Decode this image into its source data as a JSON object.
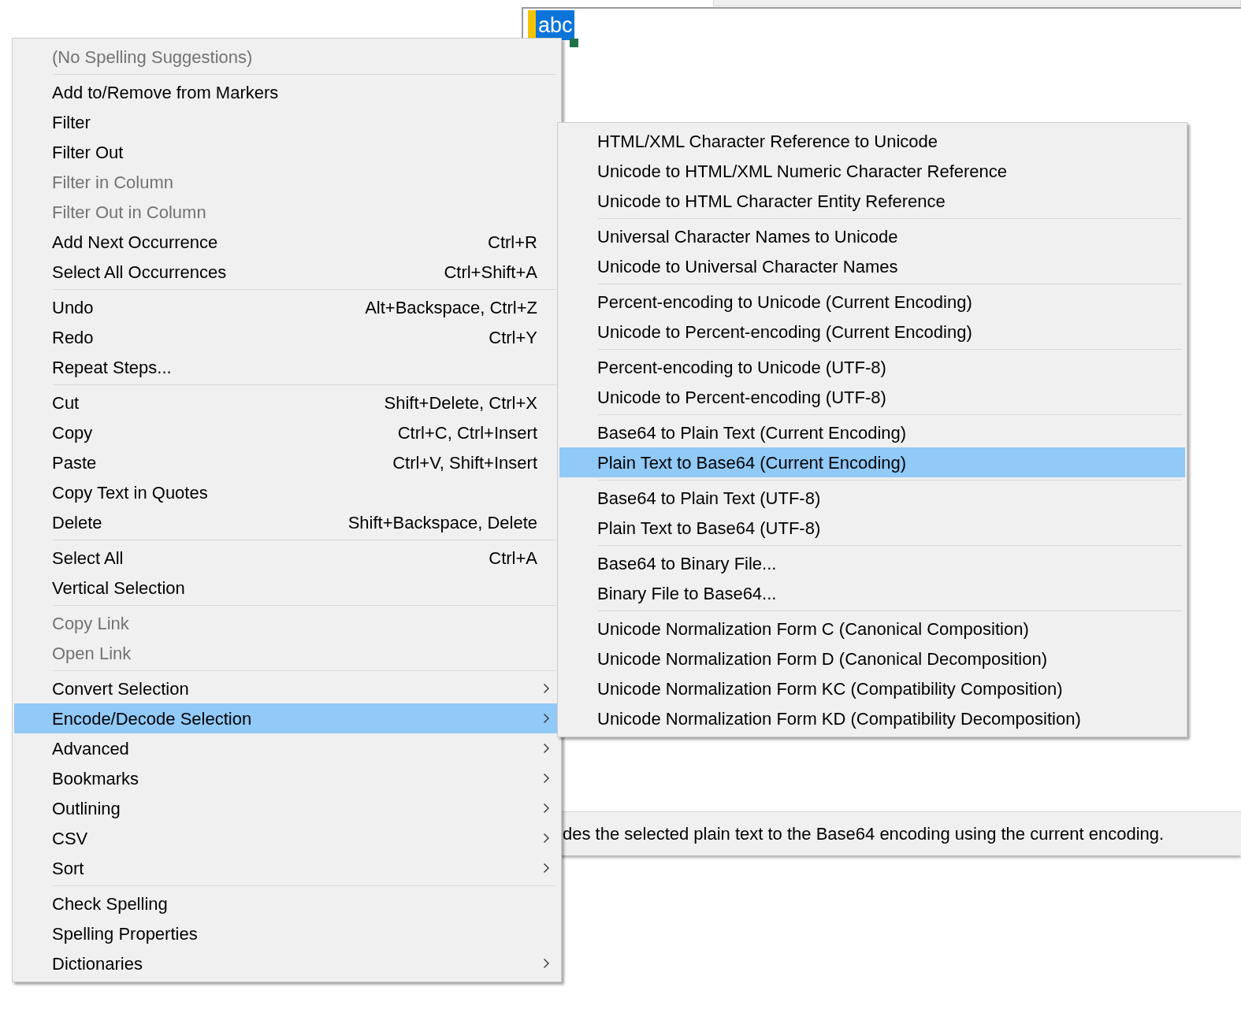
{
  "editor": {
    "text": "abc",
    "status_text": "des the selected plain text to the Base64 encoding using the current encoding."
  },
  "context_menu": {
    "groups": [
      [
        {
          "label": "(No Spelling Suggestions)",
          "disabled": true,
          "submenu": false,
          "selected": false
        }
      ],
      [
        {
          "label": "Add to/Remove from Markers",
          "disabled": false,
          "submenu": false,
          "selected": false
        },
        {
          "label": "Filter",
          "disabled": false,
          "submenu": false,
          "selected": false
        },
        {
          "label": "Filter Out",
          "disabled": false,
          "submenu": false,
          "selected": false
        },
        {
          "label": "Filter in Column",
          "disabled": true,
          "submenu": false,
          "selected": false
        },
        {
          "label": "Filter Out in Column",
          "disabled": true,
          "submenu": false,
          "selected": false
        },
        {
          "label": "Add Next Occurrence",
          "shortcut": "Ctrl+R",
          "disabled": false,
          "submenu": false,
          "selected": false
        },
        {
          "label": "Select All Occurrences",
          "shortcut": "Ctrl+Shift+A",
          "disabled": false,
          "submenu": false,
          "selected": false
        }
      ],
      [
        {
          "label": "Undo",
          "shortcut": "Alt+Backspace, Ctrl+Z",
          "disabled": false,
          "submenu": false,
          "selected": false
        },
        {
          "label": "Redo",
          "shortcut": "Ctrl+Y",
          "disabled": false,
          "submenu": false,
          "selected": false
        },
        {
          "label": "Repeat Steps...",
          "disabled": false,
          "submenu": false,
          "selected": false
        }
      ],
      [
        {
          "label": "Cut",
          "shortcut": "Shift+Delete, Ctrl+X",
          "disabled": false,
          "submenu": false,
          "selected": false
        },
        {
          "label": "Copy",
          "shortcut": "Ctrl+C, Ctrl+Insert",
          "disabled": false,
          "submenu": false,
          "selected": false
        },
        {
          "label": "Paste",
          "shortcut": "Ctrl+V, Shift+Insert",
          "disabled": false,
          "submenu": false,
          "selected": false
        },
        {
          "label": "Copy Text in Quotes",
          "disabled": false,
          "submenu": false,
          "selected": false
        },
        {
          "label": "Delete",
          "shortcut": "Shift+Backspace, Delete",
          "disabled": false,
          "submenu": false,
          "selected": false
        }
      ],
      [
        {
          "label": "Select All",
          "shortcut": "Ctrl+A",
          "disabled": false,
          "submenu": false,
          "selected": false
        },
        {
          "label": "Vertical Selection",
          "disabled": false,
          "submenu": false,
          "selected": false
        }
      ],
      [
        {
          "label": "Copy Link",
          "disabled": true,
          "submenu": false,
          "selected": false
        },
        {
          "label": "Open Link",
          "disabled": true,
          "submenu": false,
          "selected": false
        }
      ],
      [
        {
          "label": "Convert Selection",
          "disabled": false,
          "submenu": true,
          "selected": false
        },
        {
          "label": "Encode/Decode Selection",
          "disabled": false,
          "submenu": true,
          "selected": true
        },
        {
          "label": "Advanced",
          "disabled": false,
          "submenu": true,
          "selected": false
        },
        {
          "label": "Bookmarks",
          "disabled": false,
          "submenu": true,
          "selected": false
        },
        {
          "label": "Outlining",
          "disabled": false,
          "submenu": true,
          "selected": false
        },
        {
          "label": "CSV",
          "disabled": false,
          "submenu": true,
          "selected": false
        },
        {
          "label": "Sort",
          "disabled": false,
          "submenu": true,
          "selected": false
        }
      ],
      [
        {
          "label": "Check Spelling",
          "disabled": false,
          "submenu": false,
          "selected": false
        },
        {
          "label": "Spelling Properties",
          "disabled": false,
          "submenu": false,
          "selected": false
        },
        {
          "label": "Dictionaries",
          "disabled": false,
          "submenu": true,
          "selected": false
        }
      ]
    ]
  },
  "submenu": {
    "groups": [
      [
        {
          "label": "HTML/XML Character Reference to Unicode",
          "selected": false
        },
        {
          "label": "Unicode to HTML/XML Numeric Character Reference",
          "selected": false
        },
        {
          "label": "Unicode to HTML Character Entity Reference",
          "selected": false
        }
      ],
      [
        {
          "label": "Universal Character Names to Unicode",
          "selected": false
        },
        {
          "label": "Unicode to Universal Character Names",
          "selected": false
        }
      ],
      [
        {
          "label": "Percent-encoding to Unicode (Current Encoding)",
          "selected": false
        },
        {
          "label": "Unicode to Percent-encoding (Current Encoding)",
          "selected": false
        }
      ],
      [
        {
          "label": "Percent-encoding to Unicode (UTF-8)",
          "selected": false
        },
        {
          "label": "Unicode to Percent-encoding (UTF-8)",
          "selected": false
        }
      ],
      [
        {
          "label": "Base64 to Plain Text (Current Encoding)",
          "selected": false
        },
        {
          "label": "Plain Text to Base64 (Current Encoding)",
          "selected": true
        }
      ],
      [
        {
          "label": "Base64 to Plain Text (UTF-8)",
          "selected": false
        },
        {
          "label": "Plain Text to Base64 (UTF-8)",
          "selected": false
        }
      ],
      [
        {
          "label": "Base64 to Binary File...",
          "selected": false
        },
        {
          "label": "Binary File to Base64...",
          "selected": false
        }
      ],
      [
        {
          "label": "Unicode Normalization Form C (Canonical Composition)",
          "selected": false
        },
        {
          "label": "Unicode Normalization Form D (Canonical Decomposition)",
          "selected": false
        },
        {
          "label": "Unicode Normalization Form KC (Compatibility Composition)",
          "selected": false
        },
        {
          "label": "Unicode Normalization Form KD (Compatibility Decomposition)",
          "selected": false
        }
      ]
    ]
  }
}
